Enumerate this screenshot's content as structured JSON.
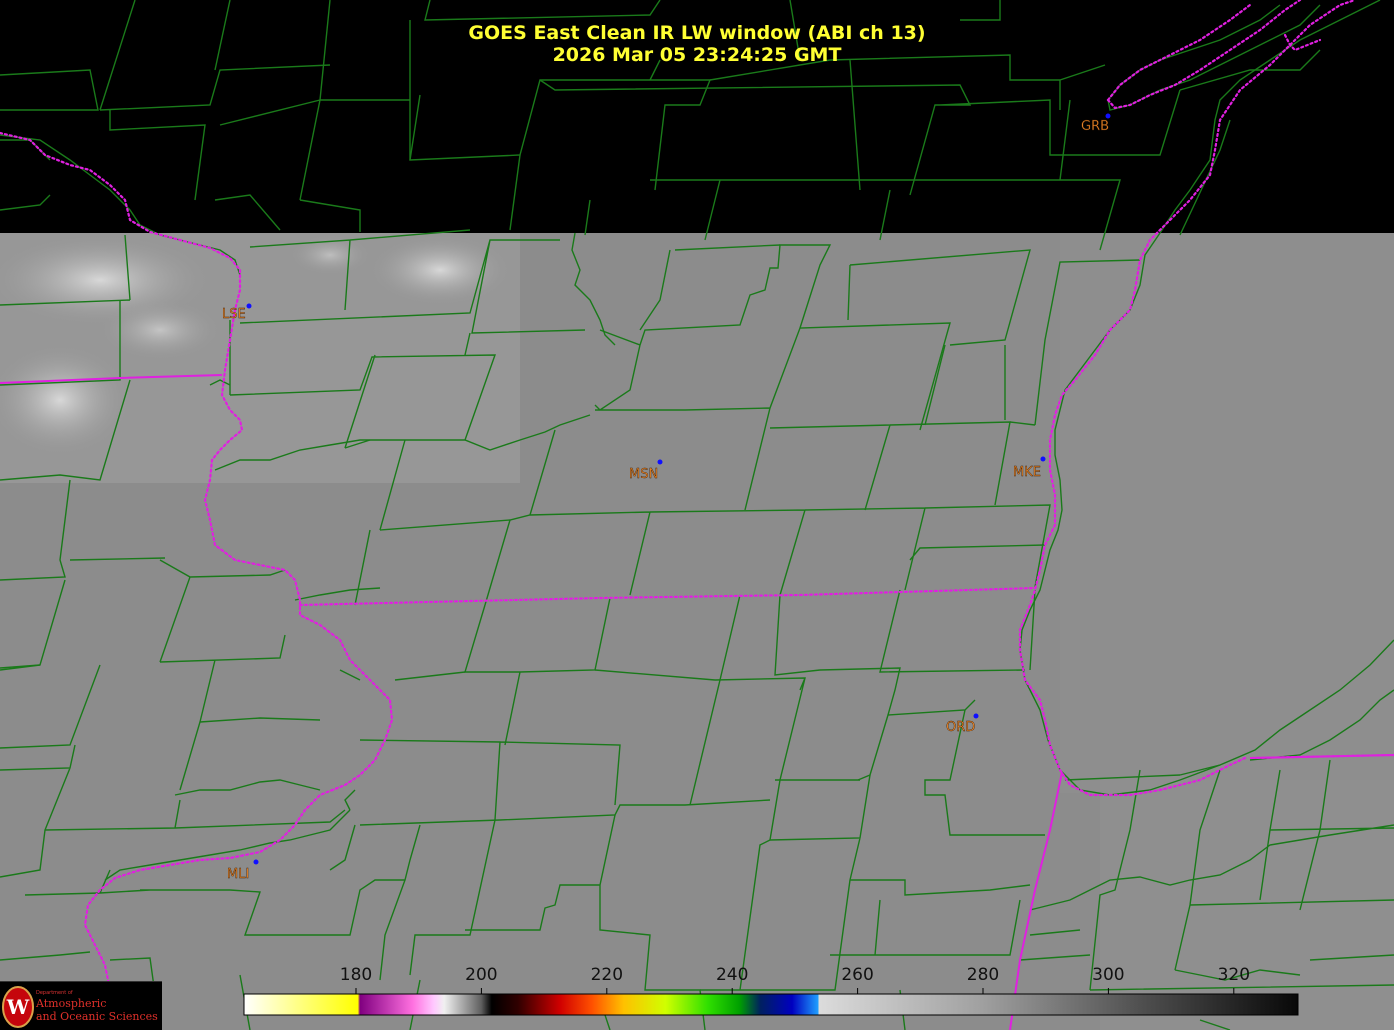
{
  "title": {
    "line1": "GOES East Clean IR LW window (ABI ch 13)",
    "line2": "2026 Mar 05  23:24:25 GMT"
  },
  "stations": [
    {
      "id": "GRB",
      "color": "#e8842a"
    },
    {
      "id": "LSE",
      "color": "#f08a2a"
    },
    {
      "id": "MSN",
      "color": "#f08a2a"
    },
    {
      "id": "MKE",
      "color": "#f08a2a"
    },
    {
      "id": "ORD",
      "color": "#f08a2a"
    },
    {
      "id": "MLI",
      "color": "#f08a2a"
    }
  ],
  "colorbar": {
    "ticks": [
      "180",
      "200",
      "220",
      "240",
      "260",
      "280",
      "300",
      "320"
    ]
  },
  "logo": {
    "dept": "Department of",
    "line1": "Atmospheric",
    "line2": "and Oceanic Sciences"
  },
  "colors": {
    "county_lines": "#1a7a1a",
    "state_lines": "#e020e0",
    "title": "#ffff33",
    "station_dot": "#1010ff"
  }
}
